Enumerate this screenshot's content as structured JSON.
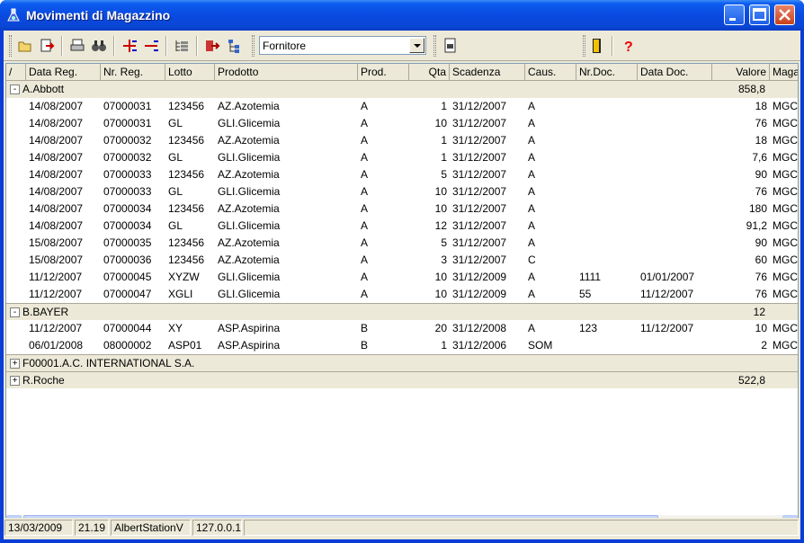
{
  "window": {
    "title": "Movimenti di Magazzino"
  },
  "toolbar": {
    "icons": [
      "open-folder-icon",
      "export-icon",
      "print-icon",
      "binoculars-icon",
      "expand-all-icon",
      "collapse-all-icon",
      "tree-list-icon",
      "exit-arrow-icon",
      "hierarchy-icon",
      "pdf-export-icon",
      "door-exit-icon",
      "help-icon"
    ],
    "group_by": "Fornitore"
  },
  "columns": [
    "/",
    "Data Reg.",
    "Nr. Reg.",
    "Lotto",
    "Prodotto",
    "Prod.",
    "Qta",
    "Scadenza",
    "Caus.",
    "Nr.Doc.",
    "Data Doc.",
    "Valore",
    "Maga"
  ],
  "groups": [
    {
      "name": "A.Abbott",
      "value": "858,8",
      "expanded": "-",
      "rows": [
        [
          "14/08/2007",
          "07000031",
          "123456",
          "AZ.Azotemia",
          "A",
          "1",
          "31/12/2007",
          "A",
          "",
          "",
          "18",
          "MGC"
        ],
        [
          "14/08/2007",
          "07000031",
          "GL",
          "GLI.Glicemia",
          "A",
          "10",
          "31/12/2007",
          "A",
          "",
          "",
          "76",
          "MGC"
        ],
        [
          "14/08/2007",
          "07000032",
          "123456",
          "AZ.Azotemia",
          "A",
          "1",
          "31/12/2007",
          "A",
          "",
          "",
          "18",
          "MGC"
        ],
        [
          "14/08/2007",
          "07000032",
          "GL",
          "GLI.Glicemia",
          "A",
          "1",
          "31/12/2007",
          "A",
          "",
          "",
          "7,6",
          "MGC"
        ],
        [
          "14/08/2007",
          "07000033",
          "123456",
          "AZ.Azotemia",
          "A",
          "5",
          "31/12/2007",
          "A",
          "",
          "",
          "90",
          "MGC"
        ],
        [
          "14/08/2007",
          "07000033",
          "GL",
          "GLI.Glicemia",
          "A",
          "10",
          "31/12/2007",
          "A",
          "",
          "",
          "76",
          "MGC"
        ],
        [
          "14/08/2007",
          "07000034",
          "123456",
          "AZ.Azotemia",
          "A",
          "10",
          "31/12/2007",
          "A",
          "",
          "",
          "180",
          "MGC"
        ],
        [
          "14/08/2007",
          "07000034",
          "GL",
          "GLI.Glicemia",
          "A",
          "12",
          "31/12/2007",
          "A",
          "",
          "",
          "91,2",
          "MGC"
        ],
        [
          "15/08/2007",
          "07000035",
          "123456",
          "AZ.Azotemia",
          "A",
          "5",
          "31/12/2007",
          "A",
          "",
          "",
          "90",
          "MGC"
        ],
        [
          "15/08/2007",
          "07000036",
          "123456",
          "AZ.Azotemia",
          "A",
          "3",
          "31/12/2007",
          "C",
          "",
          "",
          "60",
          "MGC"
        ],
        [
          "11/12/2007",
          "07000045",
          "XYZW",
          "GLI.Glicemia",
          "A",
          "10",
          "31/12/2009",
          "A",
          "1111",
          "01/01/2007",
          "76",
          "MGC"
        ],
        [
          "11/12/2007",
          "07000047",
          "XGLI",
          "GLI.Glicemia",
          "A",
          "10",
          "31/12/2009",
          "A",
          "55",
          "11/12/2007",
          "76",
          "MGC"
        ]
      ]
    },
    {
      "name": "B.BAYER",
      "value": "12",
      "expanded": "-",
      "rows": [
        [
          "11/12/2007",
          "07000044",
          "XY",
          "ASP.Aspirina",
          "B",
          "20",
          "31/12/2008",
          "A",
          "123",
          "11/12/2007",
          "10",
          "MGC"
        ],
        [
          "06/01/2008",
          "08000002",
          "ASP01",
          "ASP.Aspirina",
          "B",
          "1",
          "31/12/2006",
          "SOM",
          "",
          "",
          "2",
          "MGC"
        ]
      ]
    },
    {
      "name": "F00001.A.C. INTERNATIONAL S.A.",
      "value": "",
      "expanded": "+",
      "rows": []
    },
    {
      "name": "R.Roche",
      "value": "522,8",
      "expanded": "+",
      "rows": []
    }
  ],
  "status": [
    "13/03/2009",
    "21.19",
    "AlbertStationV",
    "127.0.0.1"
  ]
}
